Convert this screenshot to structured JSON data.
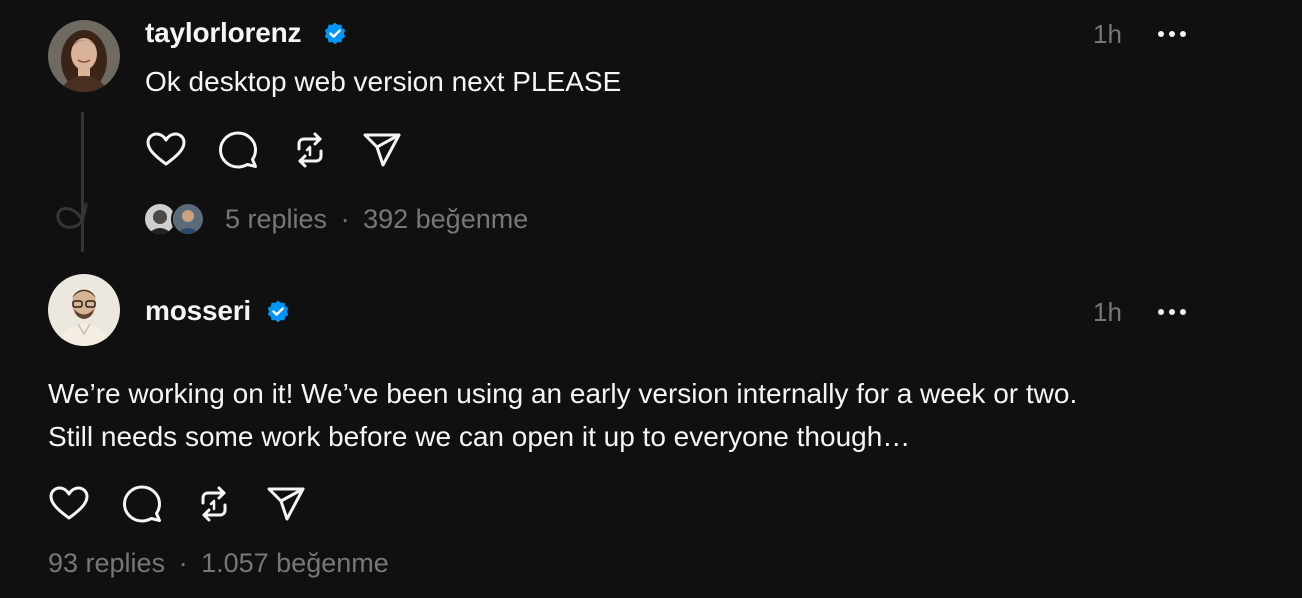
{
  "posts": [
    {
      "username": "taylorlorenz",
      "verified": true,
      "time": "1h",
      "text_lines": [
        "Ok desktop web version next PLEASE"
      ],
      "replies": "5 replies",
      "separator": "·",
      "likes": "392 beğenme",
      "avatar_colors": {
        "skin": "#d8b39a",
        "hair": "#3a2418",
        "bg": "#6f6a5f"
      }
    },
    {
      "username": "mosseri",
      "verified": true,
      "time": "1h",
      "text_lines": [
        "We’re working on it! We’ve been using an early version internally for a week or two.",
        "Still needs some work before we can open it up to everyone though…"
      ],
      "replies": "93 replies",
      "separator": "·",
      "likes": "1.057 beğenme",
      "avatar_colors": {
        "skin": "#d7b494",
        "hair": "#2b211c",
        "bg": "#ece8df"
      }
    }
  ],
  "colors": {
    "background": "#101010",
    "primary_text": "#f3f5f7",
    "secondary_text": "#777777",
    "verified_badge": "#0095f6",
    "thread_line": "#333638"
  },
  "icons": [
    "heart-icon",
    "comment-icon",
    "repost-icon",
    "share-icon",
    "more-icon",
    "verified-badge-icon"
  ]
}
